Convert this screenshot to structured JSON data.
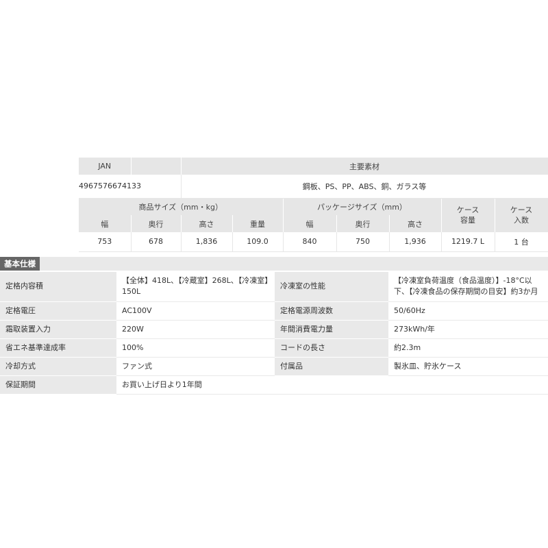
{
  "top_table": {
    "jan_header": "JAN",
    "material_header": "主要素材",
    "jan_value": "4967576674133",
    "material_value": "鋼板、PS、PP、ABS、銅、ガラス等",
    "product_size_header": "商品サイズ（mm・kg）",
    "package_size_header": "パッケージサイズ（mm）",
    "case_capacity_header": "ケース\n容量",
    "case_count_header": "ケース\n入数",
    "sub_width": "幅",
    "sub_depth": "奥行",
    "sub_height": "高さ",
    "sub_weight": "重量",
    "pkg_width": "幅",
    "pkg_depth": "奥行",
    "pkg_height": "高さ",
    "values": {
      "width": "753",
      "depth": "678",
      "height": "1,836",
      "weight": "109.0",
      "pkg_width": "840",
      "pkg_depth": "750",
      "pkg_height": "1,936",
      "case_capacity": "1219.7 L",
      "case_count": "1 台"
    }
  },
  "spec": {
    "title": "基本仕様",
    "rows": [
      {
        "l1": "定格内容積",
        "v1": "【全体】418L、【冷蔵室】268L、【冷凍室】150L",
        "l2": "冷凍室の性能",
        "v2": "【冷凍室負荷温度（食品温度）】-18°C以下、【冷凍食品の保存期間の目安】約3か月"
      },
      {
        "l1": "定格電圧",
        "v1": "AC100V",
        "l2": "定格電源周波数",
        "v2": "50/60Hz"
      },
      {
        "l1": "霜取装置入力",
        "v1": "220W",
        "l2": "年間消費電力量",
        "v2": "273kWh/年"
      },
      {
        "l1": "省エネ基準達成率",
        "v1": "100%",
        "l2": "コードの長さ",
        "v2": "約2.3m"
      },
      {
        "l1": "冷却方式",
        "v1": "ファン式",
        "l2": "付属品",
        "v2": "製氷皿、貯氷ケース"
      },
      {
        "l1": "保証期間",
        "v1": "お買い上げ日より1年間",
        "l2": "",
        "v2": ""
      }
    ]
  }
}
